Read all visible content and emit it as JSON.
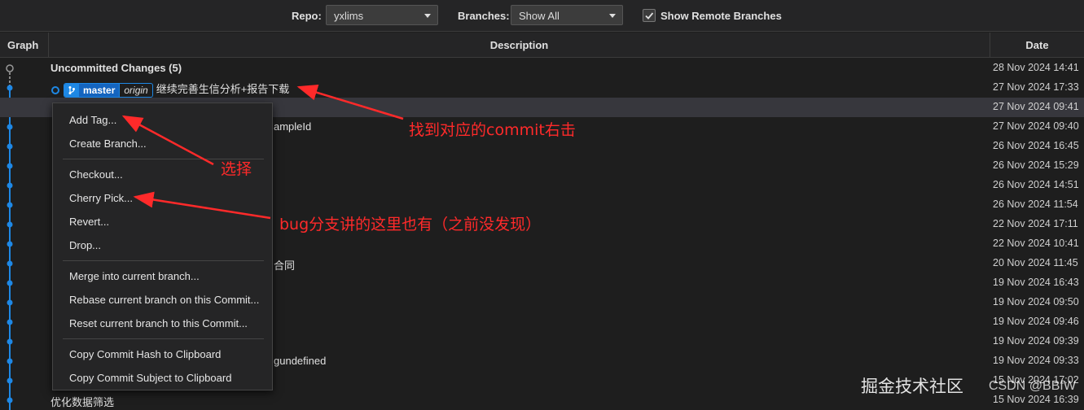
{
  "toolbar": {
    "repo_label": "Repo:",
    "repo_value": "yxlims",
    "branches_label": "Branches:",
    "branches_value": "Show All",
    "show_remote_label": "Show Remote Branches",
    "show_remote_checked": true
  },
  "columns": {
    "graph": "Graph",
    "description": "Description",
    "date": "Date"
  },
  "branch_tag": {
    "branch": "master",
    "remote": "origin"
  },
  "rows": [
    {
      "desc": "Uncommitted Changes (5)",
      "date": "28 Nov 2024 14:41"
    },
    {
      "desc": "继续完善生信分析+报告下载",
      "date": "27 Nov 2024 17:33"
    },
    {
      "desc": "",
      "date": "27 Nov 2024 09:41"
    },
    {
      "desc": "ampleId",
      "date": "27 Nov 2024 09:40"
    },
    {
      "desc": "",
      "date": "26 Nov 2024 16:45"
    },
    {
      "desc": "",
      "date": "26 Nov 2024 15:29"
    },
    {
      "desc": "",
      "date": "26 Nov 2024 14:51"
    },
    {
      "desc": "",
      "date": "26 Nov 2024 11:54"
    },
    {
      "desc": "",
      "date": "22 Nov 2024 17:11"
    },
    {
      "desc": "",
      "date": "22 Nov 2024 10:41"
    },
    {
      "desc": "合同",
      "date": "20 Nov 2024 11:45"
    },
    {
      "desc": "",
      "date": "19 Nov 2024 16:43"
    },
    {
      "desc": "",
      "date": "19 Nov 2024 09:50"
    },
    {
      "desc": "",
      "date": "19 Nov 2024 09:46"
    },
    {
      "desc": "",
      "date": "19 Nov 2024 09:39"
    },
    {
      "desc": "gundefined",
      "date": "19 Nov 2024 09:33"
    },
    {
      "desc": "",
      "date": "15 Nov 2024 17:02"
    },
    {
      "desc": "优化数据筛选",
      "date": "15 Nov 2024 16:39"
    }
  ],
  "context_menu": {
    "add_tag": "Add Tag...",
    "create_branch": "Create Branch...",
    "checkout": "Checkout...",
    "cherry_pick": "Cherry Pick...",
    "revert": "Revert...",
    "drop": "Drop...",
    "merge": "Merge into current branch...",
    "rebase": "Rebase current branch on this Commit...",
    "reset": "Reset current branch to this Commit...",
    "copy_hash": "Copy Commit Hash to Clipboard",
    "copy_subject": "Copy Commit Subject to Clipboard"
  },
  "annotations": {
    "find_commit": "找到对应的commit右击",
    "select": "选择",
    "bug_branch": "bug分支讲的这里也有（之前没发现）"
  },
  "watermark": {
    "main": "掘金技术社区",
    "sub": "CSDN @BBfW"
  },
  "colors": {
    "graph_line": "#1e88e5",
    "annotation": "#ff2a2a",
    "branch_bg": "#1565c0"
  }
}
